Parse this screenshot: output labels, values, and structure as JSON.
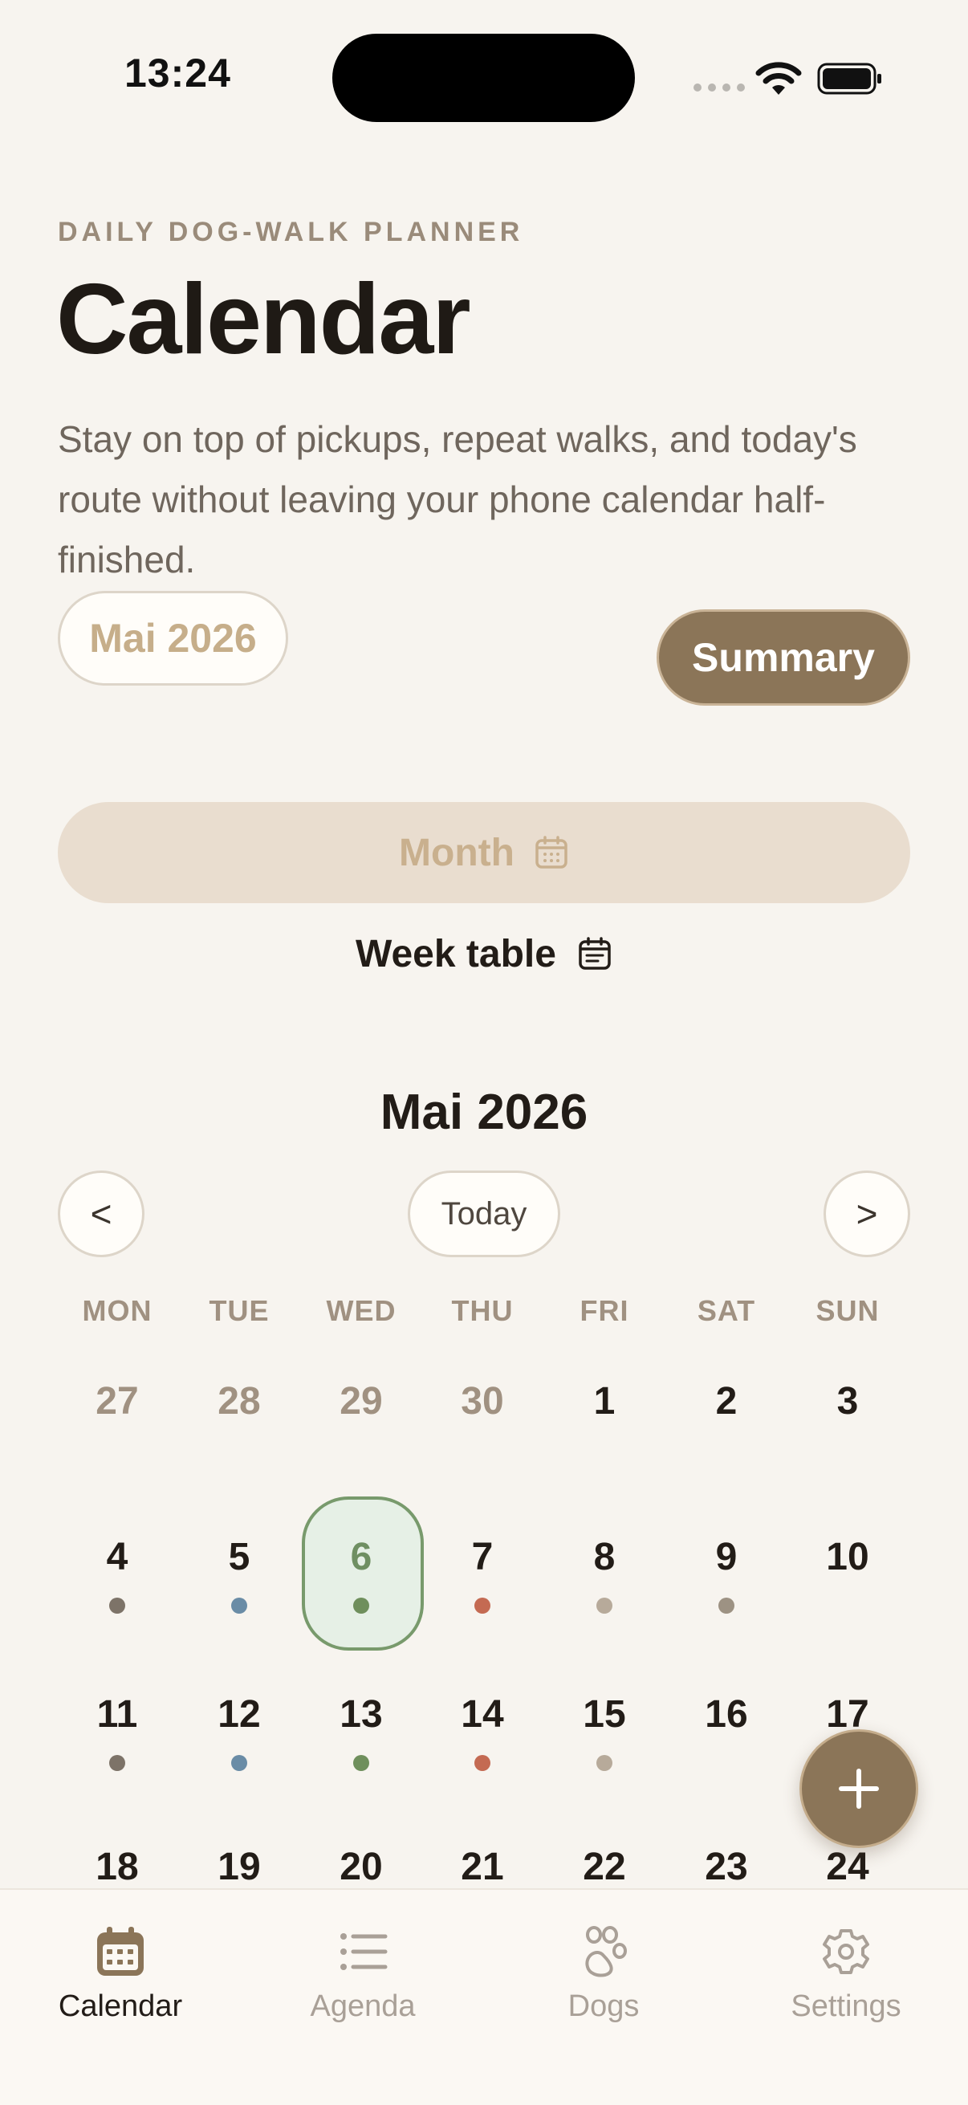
{
  "status_bar": {
    "time": "13:24"
  },
  "header": {
    "eyebrow": "DAILY DOG-WALK PLANNER",
    "title": "Calendar",
    "subtitle": "Stay on top of pickups, repeat walks, and today's route without leaving your phone calendar half-finished.",
    "month_pill": "Mai 2026",
    "summary_button": "Summary"
  },
  "view_toggle": {
    "month_label": "Month",
    "week_label": "Week table"
  },
  "calendar": {
    "title": "Mai 2026",
    "prev_label": "<",
    "next_label": ">",
    "today_label": "Today",
    "weekdays": [
      "MON",
      "TUE",
      "WED",
      "THU",
      "FRI",
      "SAT",
      "SUN"
    ],
    "weeks": [
      [
        {
          "d": "27",
          "muted": true
        },
        {
          "d": "28",
          "muted": true
        },
        {
          "d": "29",
          "muted": true
        },
        {
          "d": "30",
          "muted": true
        },
        {
          "d": "1"
        },
        {
          "d": "2"
        },
        {
          "d": "3"
        }
      ],
      [
        {
          "d": "4",
          "dot": "#7d7368"
        },
        {
          "d": "5",
          "dot": "#6a8ca6"
        },
        {
          "d": "6",
          "dot": "#6f8f5c",
          "selected": true
        },
        {
          "d": "7",
          "dot": "#c46a52"
        },
        {
          "d": "8",
          "dot": "#b7aa9a"
        },
        {
          "d": "9",
          "dot": "#9d9283"
        },
        {
          "d": "10"
        }
      ],
      [
        {
          "d": "11",
          "dot": "#7d7368"
        },
        {
          "d": "12",
          "dot": "#6a8ca6"
        },
        {
          "d": "13",
          "dot": "#6f8f5c"
        },
        {
          "d": "14",
          "dot": "#c46a52"
        },
        {
          "d": "15",
          "dot": "#b7aa9a"
        },
        {
          "d": "16"
        },
        {
          "d": "17"
        }
      ],
      [
        {
          "d": "18"
        },
        {
          "d": "19"
        },
        {
          "d": "20"
        },
        {
          "d": "21"
        },
        {
          "d": "22"
        },
        {
          "d": "23"
        },
        {
          "d": "24"
        }
      ]
    ]
  },
  "fab": {
    "icon": "plus-icon"
  },
  "tabbar": {
    "tabs": [
      {
        "label": "Calendar",
        "icon": "calendar-icon",
        "active": true
      },
      {
        "label": "Agenda",
        "icon": "list-icon",
        "active": false
      },
      {
        "label": "Dogs",
        "icon": "paw-icon",
        "active": false
      },
      {
        "label": "Settings",
        "icon": "gear-icon",
        "active": false
      }
    ]
  },
  "colors": {
    "accent": "#8b7558",
    "selected_green": "#789a6c",
    "background": "#f7f4ef"
  }
}
